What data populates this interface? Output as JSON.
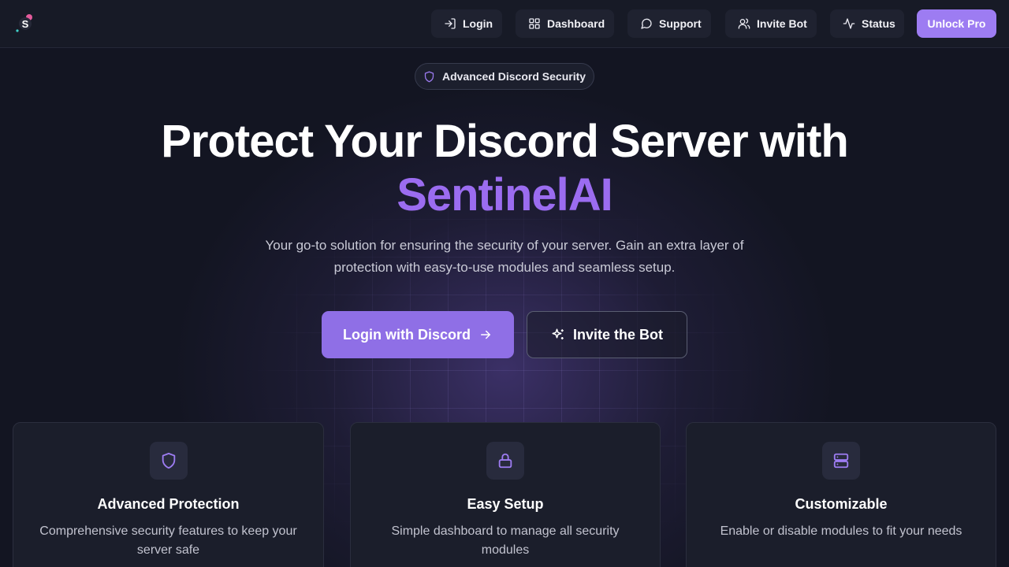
{
  "nav": {
    "login": "Login",
    "dashboard": "Dashboard",
    "support": "Support",
    "invite": "Invite Bot",
    "status": "Status",
    "pro": "Unlock Pro"
  },
  "hero": {
    "badge": "Advanced Discord Security",
    "title": "Protect Your Discord Server with",
    "brand": "SentinelAI",
    "subtitle": "Your go-to solution for ensuring the security of your server. Gain an extra layer of protection with easy-to-use modules and seamless setup.",
    "primary_cta": "Login with Discord",
    "secondary_cta": "Invite the Bot"
  },
  "features": [
    {
      "title": "Advanced Protection",
      "description": "Comprehensive security features to keep your server safe",
      "icon": "shield-icon"
    },
    {
      "title": "Easy Setup",
      "description": "Simple dashboard to manage all security modules",
      "icon": "lock-icon"
    },
    {
      "title": "Customizable",
      "description": "Enable or disable modules to fit your needs",
      "icon": "server-icon"
    }
  ],
  "colors": {
    "background": "#131522",
    "accent": "#9d7cf2",
    "brand_text": "#9b6cf0",
    "card": "#1b1e2b"
  }
}
